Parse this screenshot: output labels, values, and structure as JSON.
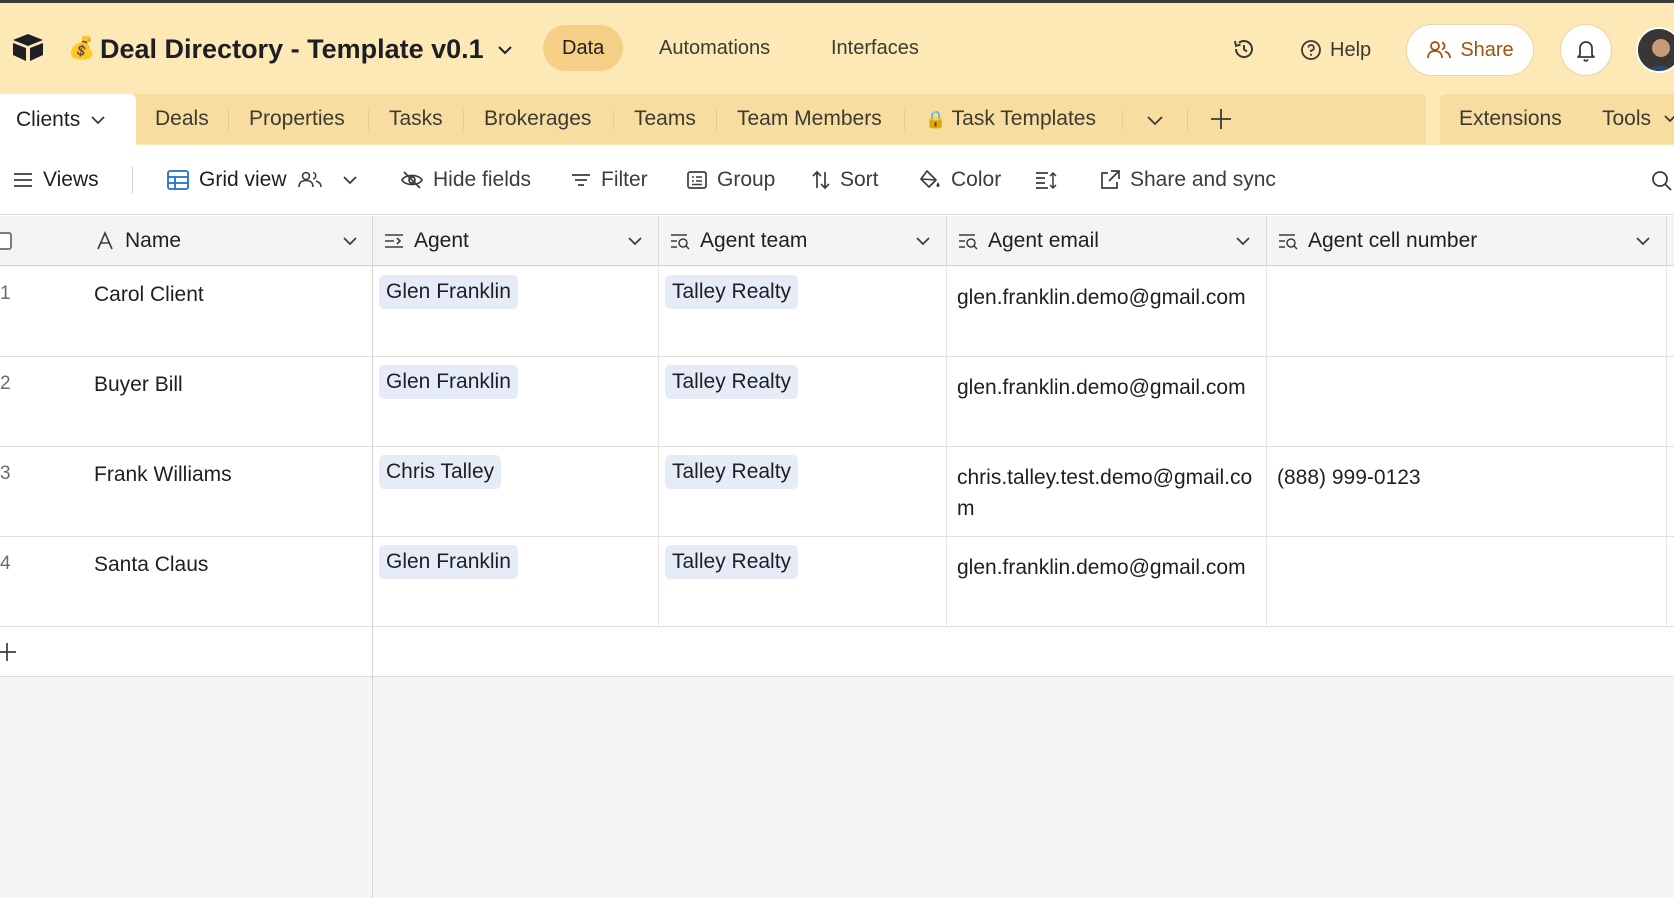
{
  "app": {
    "base_emoji": "💰",
    "base_title": "Deal Directory - Template v0.1"
  },
  "nav": {
    "data": "Data",
    "automations": "Automations",
    "interfaces": "Interfaces"
  },
  "header_actions": {
    "help": "Help",
    "share": "Share",
    "accent": "#a1520f"
  },
  "tables": {
    "active": "Clients",
    "items": [
      "Deals",
      "Properties",
      "Tasks",
      "Brokerages",
      "Teams",
      "Team Members",
      "Task Templates"
    ],
    "locked_emoji": "🔒",
    "extensions": "Extensions",
    "tools": "Tools"
  },
  "toolbar": {
    "views": "Views",
    "grid_view": "Grid view",
    "hide_fields": "Hide fields",
    "filter": "Filter",
    "group": "Group",
    "sort": "Sort",
    "color": "Color",
    "share_sync": "Share and sync"
  },
  "grid": {
    "columns": [
      {
        "label": "Name",
        "icon": "text-icon"
      },
      {
        "label": "Agent",
        "icon": "linked-record-icon"
      },
      {
        "label": "Agent team",
        "icon": "lookup-icon"
      },
      {
        "label": "Agent email",
        "icon": "lookup-icon"
      },
      {
        "label": "Agent cell number",
        "icon": "lookup-icon"
      }
    ],
    "rows": [
      {
        "num": "1",
        "name": "Carol Client",
        "agent": "Glen Franklin",
        "team": "Talley Realty",
        "email": "glen.franklin.demo@gmail.com",
        "cell": ""
      },
      {
        "num": "2",
        "name": "Buyer Bill",
        "agent": "Glen Franklin",
        "team": "Talley Realty",
        "email": "glen.franklin.demo@gmail.com",
        "cell": ""
      },
      {
        "num": "3",
        "name": "Frank Williams",
        "agent": "Chris Talley",
        "team": "Talley Realty",
        "email": "chris.talley.test.demo@gmail.com",
        "cell": "(888) 999-0123"
      },
      {
        "num": "4",
        "name": "Santa Claus",
        "agent": "Glen Franklin",
        "team": "Talley Realty",
        "email": "glen.franklin.demo@gmail.com",
        "cell": ""
      }
    ],
    "pill_color": "#e6ecf7"
  }
}
